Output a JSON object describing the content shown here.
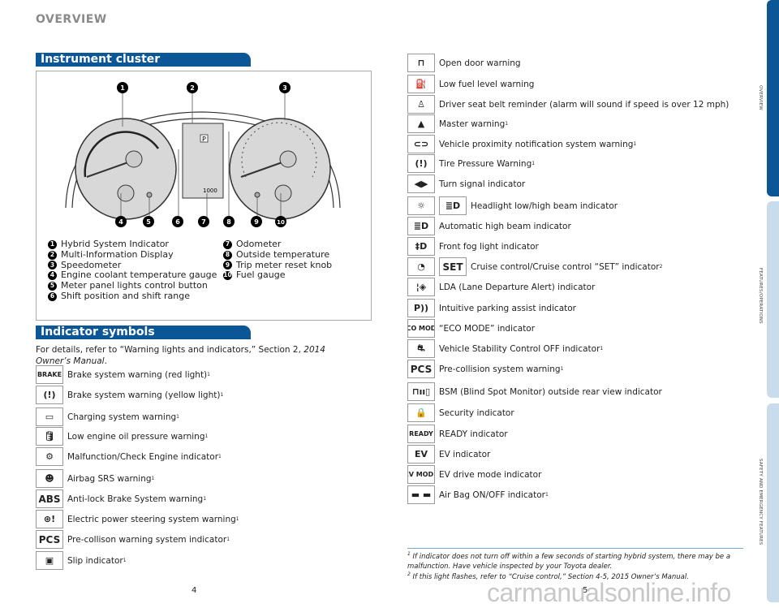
{
  "header": "OVERVIEW",
  "cluster": {
    "title": "Instrument cluster",
    "odometer": "1000",
    "shift": "P",
    "legend_left": [
      {
        "n": "1",
        "label": "Hybrid System Indicator"
      },
      {
        "n": "2",
        "label": "Multi-Information Display"
      },
      {
        "n": "3",
        "label": "Speedometer"
      },
      {
        "n": "4",
        "label": "Engine coolant temperature gauge"
      },
      {
        "n": "5",
        "label": "Meter panel lights control button"
      },
      {
        "n": "6",
        "label": "Shift position and shift range"
      }
    ],
    "legend_right": [
      {
        "n": "7",
        "label": "Odometer"
      },
      {
        "n": "8",
        "label": "Outside temperature"
      },
      {
        "n": "9",
        "label": "Trip meter reset knob"
      },
      {
        "n": "10",
        "label": "Fuel gauge"
      }
    ]
  },
  "indicators": {
    "title": "Indicator symbols",
    "intro": "For details, refer to “Warning lights and indicators,” Section 2, ",
    "intro_italic": "2014 Owner’s Manual",
    "left": [
      {
        "icon": "BRAKE",
        "label": "Brake system warning (red light)",
        "sup": "1"
      },
      {
        "icon": "brake-circle-icon",
        "label": "Brake system warning (yellow light)",
        "sup": "1"
      },
      {
        "icon": "battery-icon",
        "label": "Charging system warning",
        "sup": "1"
      },
      {
        "icon": "oil-can-icon",
        "label": "Low engine oil pressure warning",
        "sup": "1"
      },
      {
        "icon": "check-engine-icon",
        "label": "Malfunction/Check Engine indicator",
        "sup": "1"
      },
      {
        "icon": "airbag-icon",
        "label": "Airbag SRS warning",
        "sup": "1"
      },
      {
        "icon": "ABS",
        "label": "Anti-lock Brake System warning",
        "sup": "1"
      },
      {
        "icon": "steering-warning-icon",
        "label": "Electric power steering system warning",
        "sup": "1"
      },
      {
        "icon": "PCS",
        "label": "Pre-collison warning system indicator",
        "sup": "1"
      },
      {
        "icon": "slip-icon",
        "label": "Slip indicator",
        "sup": "1"
      }
    ],
    "right": [
      {
        "icon": "open-door-icon",
        "label": "Open door warning",
        "sup": ""
      },
      {
        "icon": "fuel-pump-icon",
        "label": "Low fuel level warning",
        "sup": ""
      },
      {
        "icon": "seatbelt-icon",
        "label": "Driver seat belt reminder (alarm will sound if speed is over 12 mph)",
        "sup": ""
      },
      {
        "icon": "master-warning-icon",
        "label": "Master warning",
        "sup": "1"
      },
      {
        "icon": "vehicle-proximity-icon",
        "label": "Vehicle proximity notification system warning",
        "sup": "1"
      },
      {
        "icon": "tire-pressure-icon",
        "label": "Tire Pressure Warning",
        "sup": "1"
      },
      {
        "icon": "turn-signal-icon",
        "label": "Turn signal indicator",
        "sup": ""
      },
      {
        "icon": "headlight-icon",
        "icon2": "high-beam-icon",
        "label": "Headlight low/high beam indicator",
        "sup": ""
      },
      {
        "icon": "auto-high-beam-icon",
        "label": "Automatic high beam indicator",
        "sup": ""
      },
      {
        "icon": "fog-light-icon",
        "label": "Front fog light indicator",
        "sup": ""
      },
      {
        "icon": "cruise-icon",
        "icon2": "SET",
        "label": "Cruise control/Cruise control “SET” indicator",
        "sup": "2"
      },
      {
        "icon": "lda-icon",
        "label": "LDA (Lane Departure Alert) indicator",
        "sup": ""
      },
      {
        "icon": "parking-assist-icon",
        "label": "Intuitive parking assist indicator",
        "sup": ""
      },
      {
        "icon": "ECO MODE",
        "label": "“ECO MODE” indicator",
        "sup": ""
      },
      {
        "icon": "vsc-off-icon",
        "label": "Vehicle Stability Control OFF indicator",
        "sup": "1"
      },
      {
        "icon": "PCS",
        "label": "Pre-collision system warning",
        "sup": "1"
      },
      {
        "icon": "bsm-icon",
        "label": "BSM (Blind Spot Monitor) outside rear view  indicator",
        "sup": ""
      },
      {
        "icon": "security-icon",
        "label": "Security indicator",
        "sup": ""
      },
      {
        "icon": "READY",
        "label": "READY indicator",
        "sup": ""
      },
      {
        "icon": "ev-icon",
        "label": "EV indicator",
        "sup": ""
      },
      {
        "icon": "EV MODE",
        "label": "EV drive mode indicator",
        "sup": ""
      },
      {
        "icon": "airbag-on-off-icon",
        "label": "Air Bag ON/OFF indicator",
        "sup": "1"
      }
    ]
  },
  "footnotes": [
    {
      "sup": "1",
      "text": "If indicator does not turn off within a few seconds of starting hybrid system, there may be a malfunction. Have vehicle inspected by your Toyota dealer."
    },
    {
      "sup": "2",
      "text": "If this light flashes, refer to “Cruise control,” Section 4-5, 2015 Owner’s Manual."
    }
  ],
  "page_left": "4",
  "page_right": "5",
  "side_tabs": [
    {
      "label": "OVERVIEW",
      "color": "#0a5697"
    },
    {
      "label": "FEATURES/OPERATIONS",
      "color": "#c9dcec"
    },
    {
      "label": "SAFETY AND EMERGENCY FEATURES",
      "color": "#c9dcec"
    }
  ],
  "watermark": "carmanualsonline.info"
}
